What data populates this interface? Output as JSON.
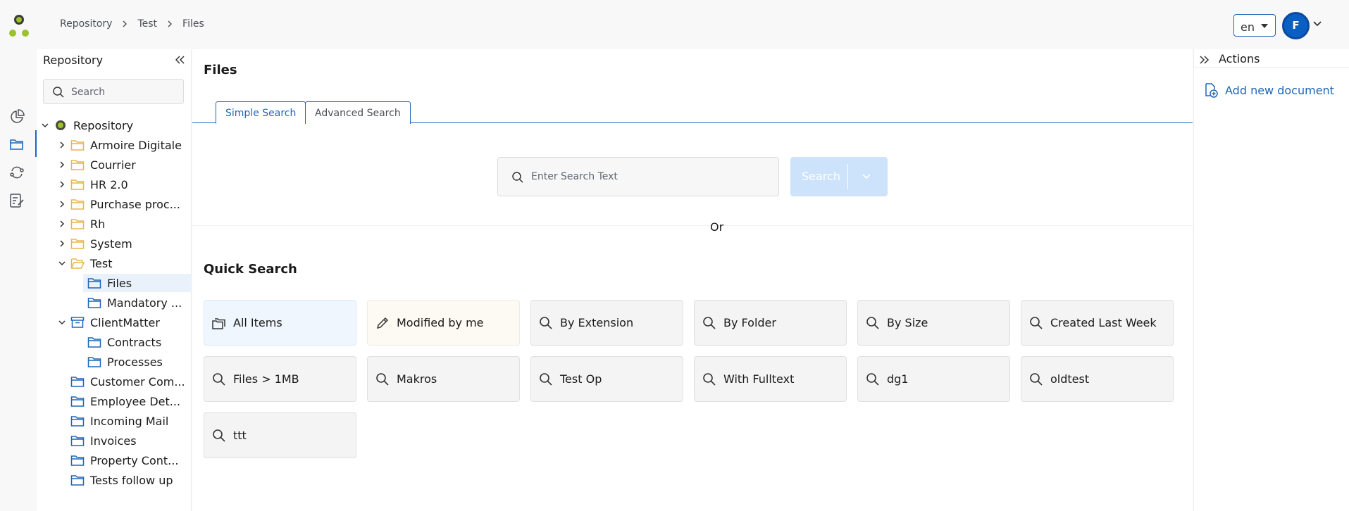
{
  "breadcrumb": [
    "Repository",
    "Test",
    "Files"
  ],
  "header": {
    "language": "en",
    "avatar_initial": "F"
  },
  "colors": {
    "accent": "#1f66b8",
    "folder": "#e8b64a",
    "folder_system": "#1f66b8",
    "logo_green": "#9cc22a"
  },
  "rail": {
    "icons": [
      "dashboard-icon",
      "repository-icon",
      "workflow-icon",
      "tasks-icon"
    ],
    "active": "repository-icon"
  },
  "tree_panel": {
    "title": "Repository",
    "search_placeholder": "Search",
    "nodes": [
      {
        "label": "Repository",
        "icon": "repository-logo-icon",
        "expanded": true
      },
      {
        "label": "Armoire Digitale",
        "icon": "folder-icon"
      },
      {
        "label": "Courrier",
        "icon": "folder-icon"
      },
      {
        "label": "HR 2.0",
        "icon": "folder-icon"
      },
      {
        "label": "Purchase proc...",
        "icon": "folder-icon"
      },
      {
        "label": "Rh",
        "icon": "folder-icon"
      },
      {
        "label": "System",
        "icon": "folder-icon"
      },
      {
        "label": "Test",
        "icon": "folder-open-icon",
        "expanded": true
      },
      {
        "label": "Files",
        "icon": "blue-folder-icon",
        "selected": true
      },
      {
        "label": "Mandatory ...",
        "icon": "blue-folder-icon"
      },
      {
        "label": "ClientMatter",
        "icon": "archive-box-icon",
        "expanded": true
      },
      {
        "label": "Contracts",
        "icon": "blue-folder-icon"
      },
      {
        "label": "Processes",
        "icon": "blue-folder-icon"
      },
      {
        "label": "Customer Com...",
        "icon": "blue-folder-icon"
      },
      {
        "label": "Employee Det...",
        "icon": "blue-folder-icon"
      },
      {
        "label": "Incoming Mail",
        "icon": "blue-folder-icon"
      },
      {
        "label": "Invoices",
        "icon": "blue-folder-icon"
      },
      {
        "label": "Property Cont...",
        "icon": "blue-folder-icon"
      },
      {
        "label": "Tests follow up",
        "icon": "blue-folder-icon"
      }
    ]
  },
  "main": {
    "title": "Files",
    "tabs": [
      {
        "label": "Simple Search",
        "active": true
      },
      {
        "label": "Advanced Search",
        "active": false
      }
    ],
    "search_placeholder": "Enter Search Text",
    "search_button": "Search",
    "or_text": "Or",
    "quick_search_title": "Quick Search",
    "quick_search": [
      {
        "label": "All Items",
        "icon": "folders-icon"
      },
      {
        "label": "Modified by me",
        "icon": "pencil-icon"
      },
      {
        "label": "By Extension",
        "icon": "search-icon"
      },
      {
        "label": "By Folder",
        "icon": "search-icon"
      },
      {
        "label": "By Size",
        "icon": "search-icon"
      },
      {
        "label": "Created Last Week",
        "icon": "search-icon"
      },
      {
        "label": "Files > 1MB",
        "icon": "search-icon"
      },
      {
        "label": "Makros",
        "icon": "search-icon"
      },
      {
        "label": "Test Op",
        "icon": "search-icon"
      },
      {
        "label": "With Fulltext",
        "icon": "search-icon"
      },
      {
        "label": "dg1",
        "icon": "search-icon"
      },
      {
        "label": "oldtest",
        "icon": "search-icon"
      },
      {
        "label": "ttt",
        "icon": "search-icon"
      }
    ]
  },
  "right_panel": {
    "title": "Actions",
    "add_document": "Add new document"
  }
}
